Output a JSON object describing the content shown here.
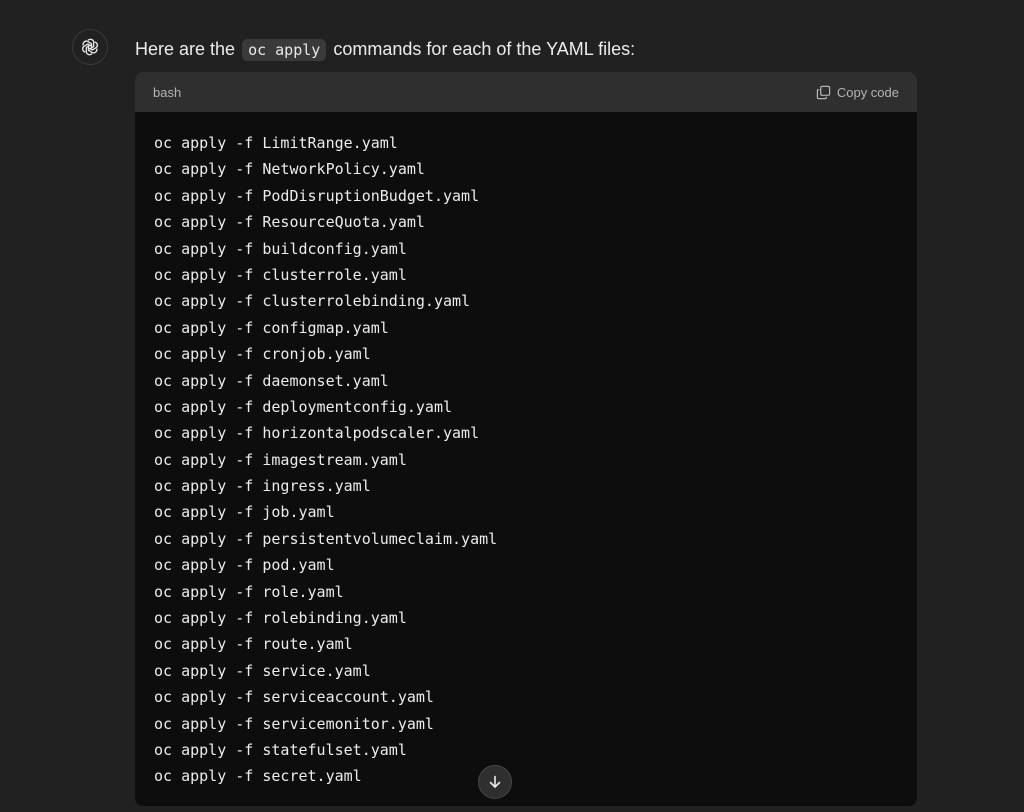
{
  "message": {
    "intro_before": "Here are the ",
    "intro_code": "oc apply",
    "intro_after": " commands for each of the YAML files:"
  },
  "code_block": {
    "language": "bash",
    "copy_label": "Copy code",
    "lines": [
      "oc apply -f LimitRange.yaml",
      "oc apply -f NetworkPolicy.yaml",
      "oc apply -f PodDisruptionBudget.yaml",
      "oc apply -f ResourceQuota.yaml",
      "oc apply -f buildconfig.yaml",
      "oc apply -f clusterrole.yaml",
      "oc apply -f clusterrolebinding.yaml",
      "oc apply -f configmap.yaml",
      "oc apply -f cronjob.yaml",
      "oc apply -f daemonset.yaml",
      "oc apply -f deploymentconfig.yaml",
      "oc apply -f horizontalpodscaler.yaml",
      "oc apply -f imagestream.yaml",
      "oc apply -f ingress.yaml",
      "oc apply -f job.yaml",
      "oc apply -f persistentvolumeclaim.yaml",
      "oc apply -f pod.yaml",
      "oc apply -f role.yaml",
      "oc apply -f rolebinding.yaml",
      "oc apply -f route.yaml",
      "oc apply -f service.yaml",
      "oc apply -f serviceaccount.yaml",
      "oc apply -f servicemonitor.yaml",
      "oc apply -f statefulset.yaml",
      "oc apply -f secret.yaml"
    ]
  },
  "icons": {
    "avatar": "assistant-logo-icon",
    "copy": "copy-icon",
    "scroll": "arrow-down-icon"
  }
}
